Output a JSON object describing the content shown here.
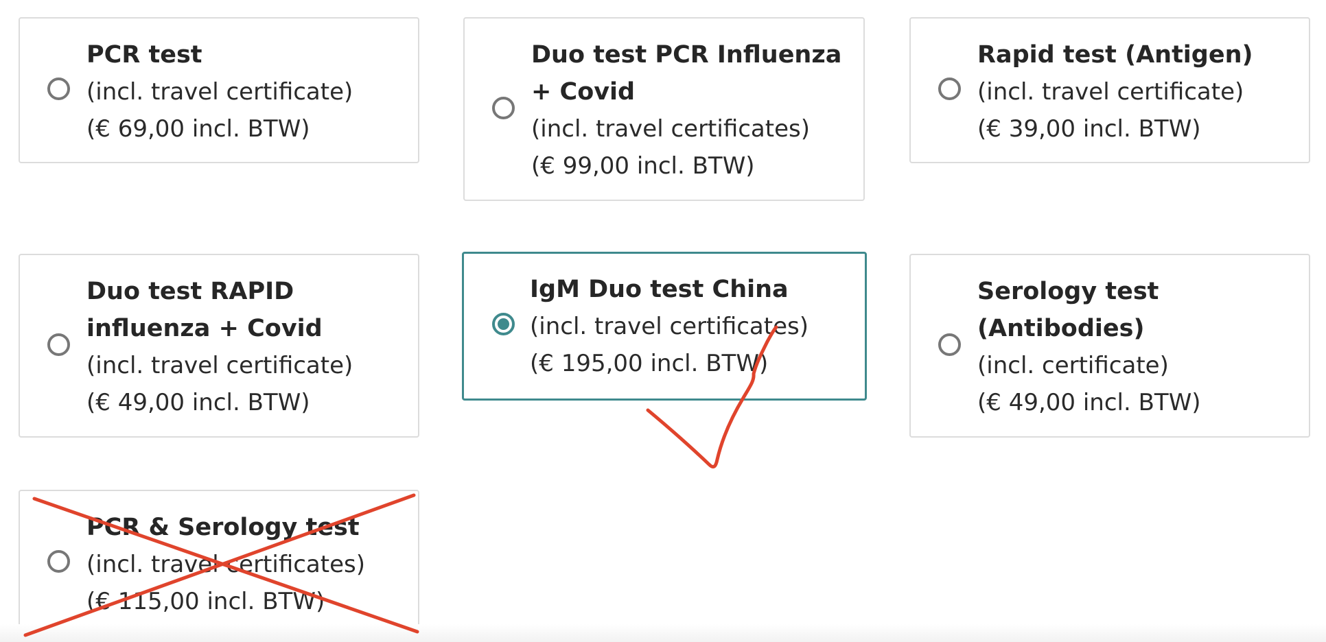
{
  "options": [
    {
      "title": "PCR test",
      "subtitle": "(incl. travel certificate)",
      "price": "(€ 69,00 incl. BTW)",
      "selected": false
    },
    {
      "title": "Duo test PCR Influenza + Covid",
      "subtitle": "(incl. travel certificates)",
      "price": "(€ 99,00 incl. BTW)",
      "selected": false
    },
    {
      "title": "Rapid test (Antigen)",
      "subtitle": "(incl. travel certificate)",
      "price": "(€ 39,00 incl. BTW)",
      "selected": false
    },
    {
      "title": "Duo test RAPID influenza + Covid",
      "subtitle": "(incl. travel certificate)",
      "price": "(€ 49,00 incl. BTW)",
      "selected": false
    },
    {
      "title": "IgM Duo test China",
      "subtitle": "(incl. travel certificates)",
      "price": "(€ 195,00 incl. BTW)",
      "selected": true
    },
    {
      "title": "Serology test (Antibodies)",
      "subtitle": "(incl. certificate)",
      "price": "(€ 49,00 incl. BTW)",
      "selected": false
    },
    {
      "title": "PCR & Serology test",
      "subtitle": "(incl. travel certificates)",
      "price": "(€ 115,00 incl. BTW)",
      "selected": false
    }
  ],
  "colors": {
    "accent": "#3f8a8d",
    "annotation_mark": "#e0442c",
    "card_border": "#dcdcdc"
  }
}
